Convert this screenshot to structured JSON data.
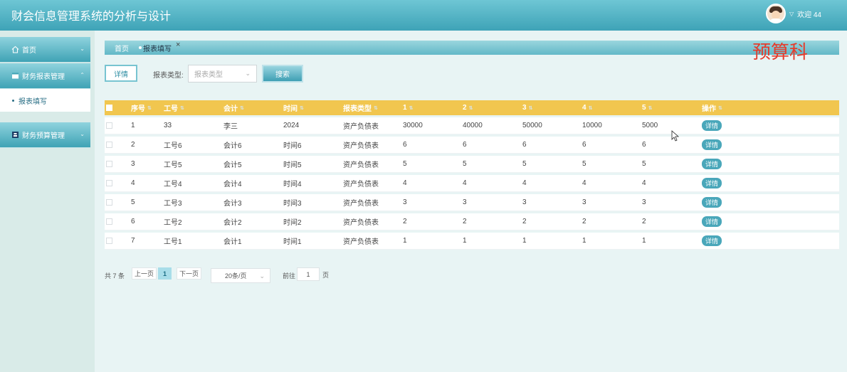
{
  "header": {
    "title": "财会信息管理系统的分析与设计",
    "welcome": "欢迎 44"
  },
  "sidebar": {
    "items": [
      {
        "label": "首页",
        "icon": "home-icon"
      },
      {
        "label": "财务报表管理",
        "icon": "report-icon"
      },
      {
        "label": "财务预算管理",
        "icon": "budget-icon"
      }
    ],
    "sub_items": [
      {
        "label": "报表填写"
      }
    ]
  },
  "tabs": {
    "home": "首页",
    "active": "报表填写",
    "close": "×"
  },
  "role_label": "预算科",
  "toolbar": {
    "detail_label": "详情",
    "filter_label": "报表类型:",
    "filter_placeholder": "报表类型",
    "search_label": "搜索"
  },
  "table": {
    "columns": [
      "序号",
      "工号",
      "会计",
      "时间",
      "报表类型",
      "1",
      "2",
      "3",
      "4",
      "5",
      "操作"
    ],
    "rows": [
      [
        "1",
        "33",
        "李三",
        "2024",
        "资产负债表",
        "30000",
        "40000",
        "50000",
        "10000",
        "5000"
      ],
      [
        "2",
        "工号6",
        "会计6",
        "时间6",
        "资产负债表",
        "6",
        "6",
        "6",
        "6",
        "6"
      ],
      [
        "3",
        "工号5",
        "会计5",
        "时间5",
        "资产负债表",
        "5",
        "5",
        "5",
        "5",
        "5"
      ],
      [
        "4",
        "工号4",
        "会计4",
        "时间4",
        "资产负债表",
        "4",
        "4",
        "4",
        "4",
        "4"
      ],
      [
        "5",
        "工号3",
        "会计3",
        "时间3",
        "资产负债表",
        "3",
        "3",
        "3",
        "3",
        "3"
      ],
      [
        "6",
        "工号2",
        "会计2",
        "时间2",
        "资产负债表",
        "2",
        "2",
        "2",
        "2",
        "2"
      ],
      [
        "7",
        "工号1",
        "会计1",
        "时间1",
        "资产负债表",
        "1",
        "1",
        "1",
        "1",
        "1"
      ]
    ],
    "action_label": "详情"
  },
  "pagination": {
    "total": "共 7 条",
    "prev": "上一页",
    "current": "1",
    "next": "下一页",
    "page_size": "20条/页",
    "goto_label": "前往",
    "goto_value": "1",
    "page_suffix": "页"
  },
  "colors": {
    "header": "#3ea3b7",
    "table_header": "#f1c64f",
    "accent": "#4aa7ba",
    "role_text": "#e53c2c"
  }
}
